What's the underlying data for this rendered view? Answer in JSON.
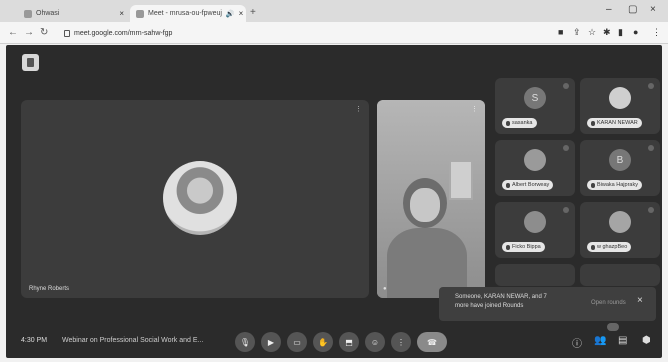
{
  "browser": {
    "tabs": [
      {
        "label": "Ohwasi"
      },
      {
        "label": "Meet - mrusa-ou-fpweuj"
      }
    ],
    "url": "meet.google.com/mrn-sahw-fgp"
  },
  "meeting": {
    "main_participant_name": "Rhyne Roberts",
    "participants": [
      {
        "name": "sasanka",
        "avatar_letter": "S"
      },
      {
        "name": "KARAN NEWAR",
        "avatar_letter": ""
      },
      {
        "name": "Albert Borweay",
        "avatar_letter": ""
      },
      {
        "name": "Biwaka Hajpraky",
        "avatar_letter": "B"
      },
      {
        "name": "Ficko Bippa",
        "avatar_letter": ""
      },
      {
        "name": "w ghazpBeo",
        "avatar_letter": ""
      }
    ],
    "toast": {
      "line1": "Someone, KARAN NEWAR, and 7",
      "line2": "more have joined Rounds",
      "action": "Open rounds"
    },
    "time": "4:30 PM",
    "title": "Webinar on Professional Social Work and E..."
  },
  "icons": {
    "controls": [
      "mic-icon",
      "camera-icon",
      "captions-icon",
      "raise-hand-icon",
      "present-icon",
      "reactions-icon",
      "more-icon",
      "end-call-icon"
    ],
    "right": [
      "info-icon",
      "people-icon",
      "chat-icon",
      "activities-icon"
    ]
  }
}
